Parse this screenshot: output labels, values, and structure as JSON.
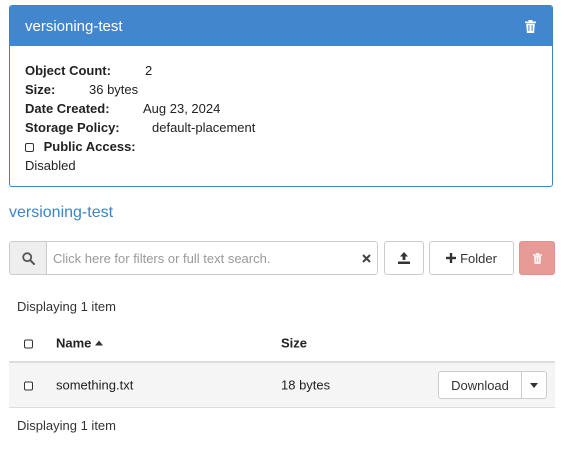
{
  "bucket_card": {
    "title": "versioning-test",
    "details": {
      "object_count_label": "Object Count:",
      "object_count_value": "2",
      "size_label": "Size:",
      "size_value": "36 bytes",
      "date_created_label": "Date Created:",
      "date_created_value": "Aug 23, 2024",
      "storage_policy_label": "Storage Policy:",
      "storage_policy_value": "default-placement",
      "public_access_label": "Public Access:",
      "public_access_value": "Disabled"
    }
  },
  "bucket_link": "versioning-test",
  "toolbar": {
    "search_placeholder": "Click here for filters or full text search.",
    "folder_label": "Folder"
  },
  "table": {
    "displaying_top": "Displaying 1 item",
    "displaying_bottom": "Displaying 1 item",
    "columns": {
      "name": "Name",
      "size": "Size"
    },
    "rows": [
      {
        "name": "something.txt",
        "size": "18 bytes",
        "action": "Download"
      }
    ]
  },
  "colors": {
    "primary": "#4287cd",
    "link": "#3c84c6",
    "danger": "#e89a97"
  },
  "icons": {
    "header_delete": "trash-icon",
    "search": "search-icon",
    "clear": "close-icon",
    "upload": "upload-icon",
    "folder": "plus-icon",
    "toolbar_delete": "trash-icon",
    "sort": "sort-ascending-icon",
    "dropdown": "chevron-down-icon"
  }
}
